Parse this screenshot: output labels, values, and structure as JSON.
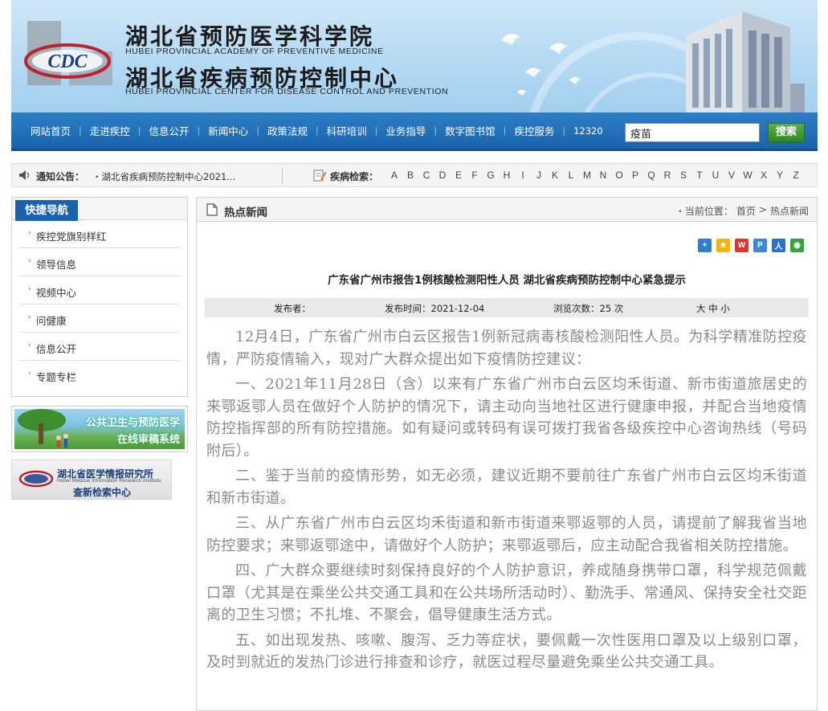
{
  "header": {
    "title_cn_1": "湖北省预防医学科学院",
    "title_en_1": "HUBEI PROVINCIAL ACADEMY OF PREVENTIVE MEDICINE",
    "title_cn_2": "湖北省疾病预防控制中心",
    "title_en_2": "HUBEI PROVINCIAL CENTER FOR DISEASE CONTROL AND PREVENTION",
    "logo_text": "CDC"
  },
  "nav": {
    "items": [
      "网站首页",
      "走进疾控",
      "信息公开",
      "新闻中心",
      "政策法规",
      "科研培训",
      "业务指导",
      "数字图书馆",
      "疾控服务",
      "12320"
    ],
    "search_value": "疫苗",
    "search_button": "搜索"
  },
  "notice": {
    "label": "通知公告：",
    "text": "・湖北省疾病预防控制中心2021...",
    "disease_label": "疾病检索：",
    "letters": [
      "A",
      "B",
      "C",
      "D",
      "E",
      "F",
      "G",
      "H",
      "I",
      "J",
      "K",
      "L",
      "M",
      "N",
      "O",
      "P",
      "Q",
      "R",
      "S",
      "T",
      "U",
      "V",
      "W",
      "X",
      "Y",
      "Z"
    ]
  },
  "sidebar": {
    "title": "快捷导航",
    "items": [
      "疾控党旗别样红",
      "领导信息",
      "视频中心",
      "问健康",
      "信息公开",
      "专题专栏"
    ],
    "ad1_line1": "公共卫生与预防医学",
    "ad1_line2": "在线审稿系统",
    "ad2_title": "湖北省医学情报研究所",
    "ad2_sub": "Hubei Medical Information Research Institute",
    "ad2_title2": "查新检索中心"
  },
  "main": {
    "section_title": "热点新闻",
    "breadcrumb_prefix": "・当前位置：",
    "breadcrumb_home": "首页",
    "breadcrumb_sep": ">",
    "breadcrumb_current": "热点新闻",
    "article_title": "广东省广州市报告1例核酸检测阳性人员  湖北省疾病预防控制中心紧急提示",
    "meta": {
      "publisher": "发布者：",
      "date": "发布时间：2021-12-04",
      "views": "浏览次数：25 次",
      "font_size": "大 中 小"
    },
    "paragraphs": [
      "12月4日，广东省广州市白云区报告1例新冠病毒核酸检测阳性人员。为科学精准防控疫情，严防疫情输入，现对广大群众提出如下疫情防控建议：",
      "一、2021年11月28日（含）以来有广东省广州市白云区均禾街道、新市街道旅居史的来鄂返鄂人员在做好个人防护的情况下，请主动向当地社区进行健康申报，并配合当地疫情防控指挥部的所有防控措施。如有疑问或转码有误可拨打我省各级疾控中心咨询热线（号码附后）。",
      "二、鉴于当前的疫情形势，如无必须，建议近期不要前往广东省广州市白云区均禾街道和新市街道。",
      "三、从广东省广州市白云区均禾街道和新市街道来鄂返鄂的人员，请提前了解我省当地防控要求；来鄂返鄂途中，请做好个人防护；来鄂返鄂后，应主动配合我省相关防控措施。",
      "四、广大群众要继续时刻保持良好的个人防护意识，养成随身携带口罩，科学规范佩戴口罩（尤其是在乘坐公共交通工具和在公共场所活动时）、勤洗手、常通风、保持安全社交距离的卫生习惯；不扎堆、不聚会，倡导健康生活方式。",
      "五、如出现发热、咳嗽、腹泻、乏力等症状，要佩戴一次性医用口罩及以上级别口罩，及时到就近的发热门诊进行排查和诊疗，就医过程尽量避免乘坐公共交通工具。"
    ]
  },
  "colors": {
    "nav_blue": "#1a63ac",
    "accent_green": "#2f8a24",
    "body_text": "#8a8a8a"
  }
}
